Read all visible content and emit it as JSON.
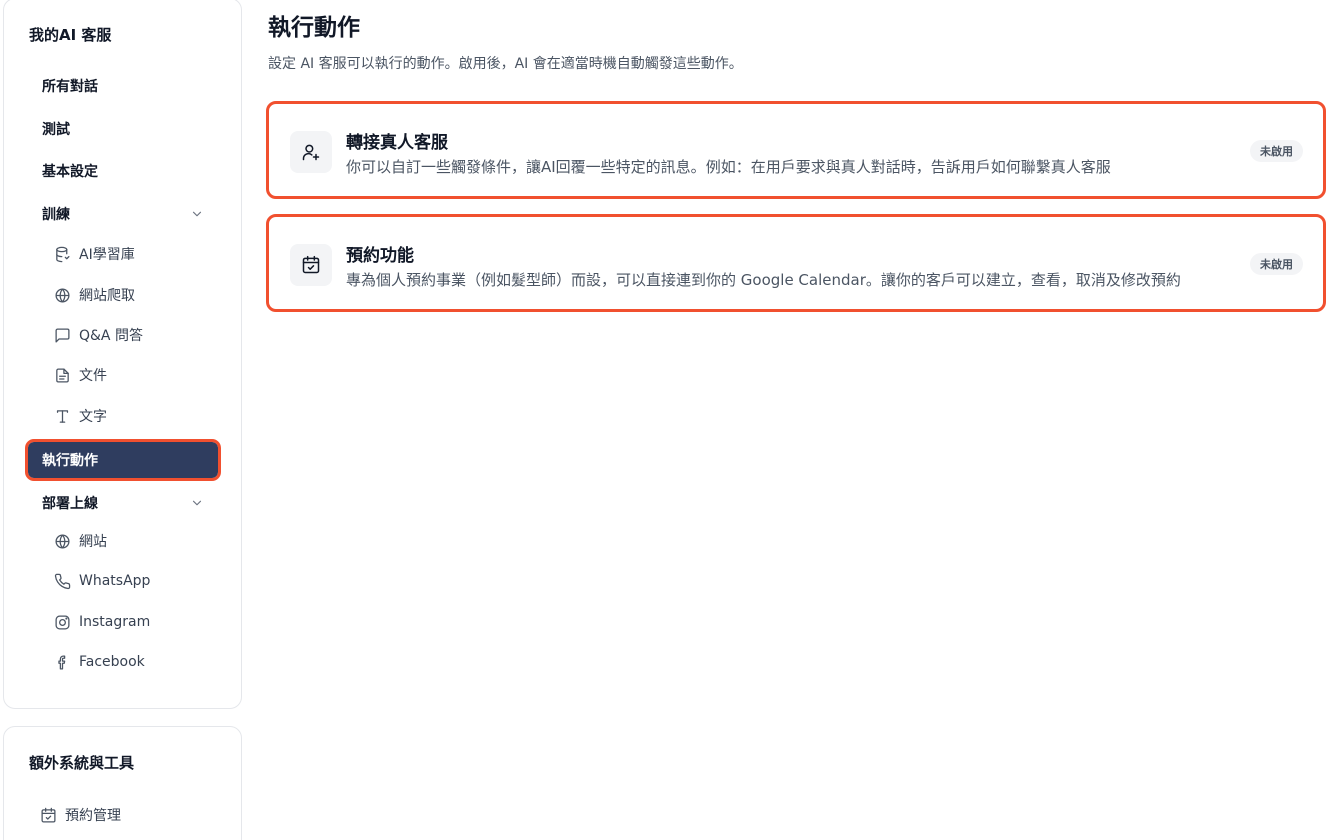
{
  "sidebar": {
    "title": "我的AI 客服",
    "items": {
      "all_conversations": "所有對話",
      "test": "測試",
      "basic_settings": "基本設定",
      "training": "訓練",
      "training_sub": [
        "AI學習庫",
        "網站爬取",
        "Q&A 問答",
        "文件",
        "文字"
      ],
      "actions": "執行動作",
      "deploy": "部署上線",
      "deploy_sub": [
        "網站",
        "WhatsApp",
        "Instagram",
        "Facebook"
      ]
    }
  },
  "extra": {
    "title": "額外系統與工具",
    "items": [
      "預約管理"
    ]
  },
  "main": {
    "title": "執行動作",
    "subtitle": "設定 AI 客服可以執行的動作。啟用後，AI 會在適當時機自動觸發這些動作。",
    "cards": [
      {
        "title": "轉接真人客服",
        "description": "你可以自訂一些觸發條件，讓AI回覆一些特定的訊息。例如：在用戶要求與真人對話時，告訴用戶如何聯繫真人客服",
        "status": "未啟用",
        "icon": "user-plus-icon"
      },
      {
        "title": "預約功能",
        "description": "專為個人預約事業（例如髮型師）而設，可以直接連到你的 Google Calendar。讓你的客戶可以建立，查看，取消及修改預約",
        "status": "未啟用",
        "icon": "calendar-check-icon"
      }
    ]
  },
  "colors": {
    "active_nav_bg": "#2f3d5f",
    "highlight_border": "#f1502f"
  }
}
